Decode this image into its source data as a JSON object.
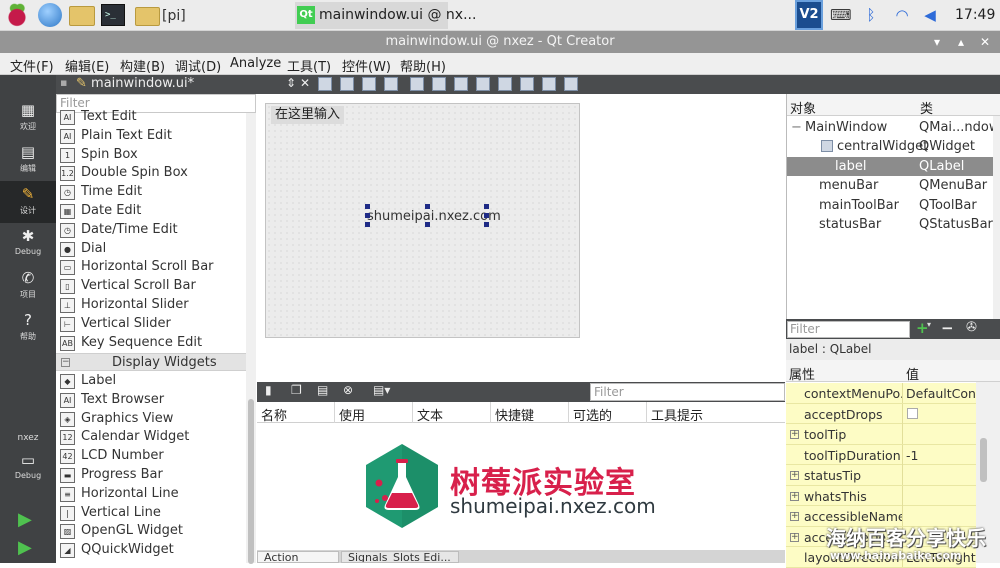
{
  "taskbar": {
    "pi_folder_label": "[pi]",
    "qt_task_label": "mainwindow.ui @ nx...",
    "qt_task_icon": "Qt",
    "vnc_icon": "V2",
    "clock": "17:49"
  },
  "window": {
    "title": "mainwindow.ui @ nxez - Qt Creator",
    "buttons": {
      "minimize": "▾",
      "maximize": "▴",
      "close": "✕"
    }
  },
  "menubar": [
    "文件(F)",
    "编辑(E)",
    "构建(B)",
    "调试(D)",
    "Analyze",
    "工具(T)",
    "控件(W)",
    "帮助(H)"
  ],
  "modes": [
    {
      "label": "欢迎",
      "icon": "grid-icon",
      "glyph": "▦"
    },
    {
      "label": "编辑",
      "icon": "edit-doc-icon",
      "glyph": "▤"
    },
    {
      "label": "设计",
      "icon": "pencil-icon",
      "glyph": "✎"
    },
    {
      "label": "Debug",
      "icon": "bug-icon",
      "glyph": "✱"
    },
    {
      "label": "项目",
      "icon": "wrench-icon",
      "glyph": "✆"
    },
    {
      "label": "帮助",
      "icon": "help-icon",
      "glyph": "?"
    }
  ],
  "kit": {
    "project": "nxez",
    "mode": "Debug"
  },
  "editor": {
    "file": "mainwindow.ui*"
  },
  "widgetbox": {
    "filter_placeholder": "Filter",
    "items_a": [
      {
        "label": "Text Edit",
        "icon": "AI"
      },
      {
        "label": "Plain Text Edit",
        "icon": "AI"
      },
      {
        "label": "Spin Box",
        "icon": "1"
      },
      {
        "label": "Double Spin Box",
        "icon": "1.2"
      },
      {
        "label": "Time Edit",
        "icon": "◷"
      },
      {
        "label": "Date Edit",
        "icon": "▦"
      },
      {
        "label": "Date/Time Edit",
        "icon": "◷"
      },
      {
        "label": "Dial",
        "icon": "●"
      },
      {
        "label": "Horizontal Scroll Bar",
        "icon": "▭"
      },
      {
        "label": "Vertical Scroll Bar",
        "icon": "▯"
      },
      {
        "label": "Horizontal Slider",
        "icon": "⊥"
      },
      {
        "label": "Vertical Slider",
        "icon": "⊢"
      },
      {
        "label": "Key Sequence Edit",
        "icon": "AB"
      }
    ],
    "category": "Display Widgets",
    "items_b": [
      {
        "label": "Label",
        "icon": "◆"
      },
      {
        "label": "Text Browser",
        "icon": "AI"
      },
      {
        "label": "Graphics View",
        "icon": "◈"
      },
      {
        "label": "Calendar Widget",
        "icon": "12"
      },
      {
        "label": "LCD Number",
        "icon": "42"
      },
      {
        "label": "Progress Bar",
        "icon": "▬"
      },
      {
        "label": "Horizontal Line",
        "icon": "≡"
      },
      {
        "label": "Vertical Line",
        "icon": "|"
      },
      {
        "label": "OpenGL Widget",
        "icon": "▨"
      },
      {
        "label": "QQuickWidget",
        "icon": "◢"
      }
    ]
  },
  "form": {
    "menu_placeholder": "在这里输入",
    "label_text": "shumeipai.nxez.com"
  },
  "actions": {
    "filter_placeholder": "Filter",
    "columns": [
      "名称",
      "使用",
      "文本",
      "快捷键",
      "可选的",
      "工具提示"
    ],
    "tabs": [
      "Action Edit...",
      "Signals_Slots Edi..."
    ]
  },
  "logo": {
    "title": "树莓派实验室",
    "subtitle": "shumeipai.nxez.com"
  },
  "objects": {
    "header": [
      "对象",
      "类"
    ],
    "rows": [
      {
        "name": "MainWindow",
        "class": "QMai...ndow",
        "level": 0,
        "expander": "−"
      },
      {
        "name": "centralWidget",
        "class": "QWidget",
        "level": 1,
        "expander": "−"
      },
      {
        "name": "label",
        "class": "QLabel",
        "level": 2,
        "selected": true
      },
      {
        "name": "menuBar",
        "class": "QMenuBar",
        "level": 1
      },
      {
        "name": "mainToolBar",
        "class": "QToolBar",
        "level": 1
      },
      {
        "name": "statusBar",
        "class": "QStatusBar",
        "level": 1
      }
    ]
  },
  "properties": {
    "filter_placeholder": "Filter",
    "context": "label : QLabel",
    "header": [
      "属性",
      "值"
    ],
    "rows": [
      {
        "name": "contextMenuPo...",
        "value": "DefaultCon..."
      },
      {
        "name": "acceptDrops",
        "value": "",
        "checkbox": true
      },
      {
        "name": "toolTip",
        "value": "",
        "expandable": true
      },
      {
        "name": "toolTipDuration",
        "value": "-1"
      },
      {
        "name": "statusTip",
        "value": "",
        "expandable": true
      },
      {
        "name": "whatsThis",
        "value": "",
        "expandable": true
      },
      {
        "name": "accessibleName",
        "value": "",
        "expandable": true
      },
      {
        "name": "accessibleDe...",
        "value": "",
        "expandable": true
      },
      {
        "name": "layoutDirection",
        "value": "LeftToRight"
      }
    ]
  },
  "watermark": {
    "line1": "海纳百客分享快乐",
    "line2": "www.hainabaike.com"
  }
}
